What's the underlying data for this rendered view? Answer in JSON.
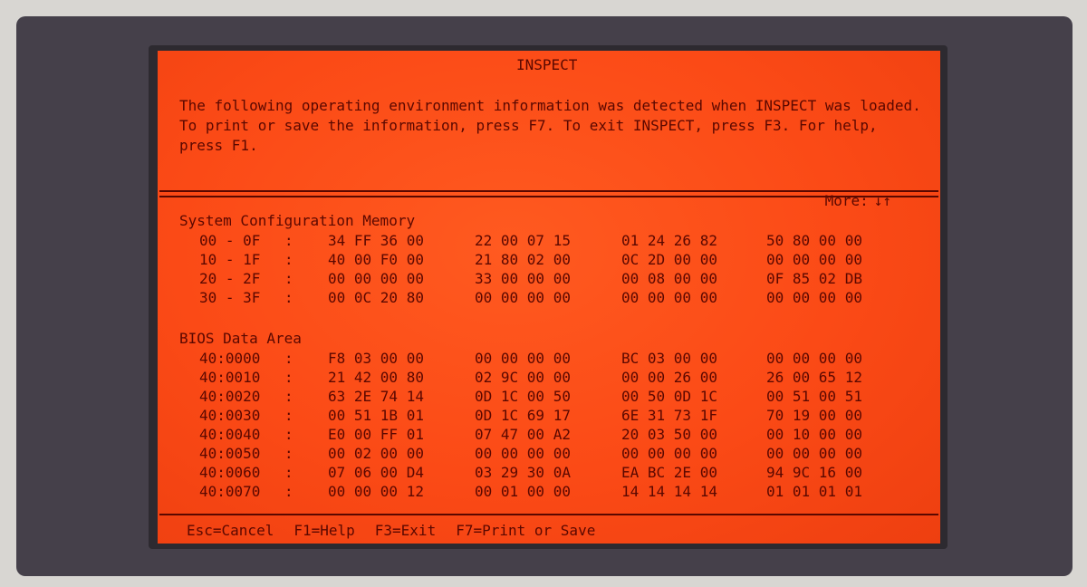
{
  "window": {
    "title": "INSPECT"
  },
  "intro": {
    "text": "The following operating environment information was detected when INSPECT was loaded. To print or save the information, press F7. To exit INSPECT, press F3. For help, press F1."
  },
  "more": {
    "label": "More:",
    "arrow": "↓↑"
  },
  "colors": {
    "screen": "#fb4a16",
    "text": "#5a0800",
    "bezel": "#45404a"
  },
  "system_config": {
    "title": "System Configuration Memory",
    "rows": [
      {
        "addr": "00 - 0F",
        "groups": [
          "34 FF 36 00",
          "22 00 07 15",
          "01 24 26 82",
          "50 80 00 00"
        ]
      },
      {
        "addr": "10 - 1F",
        "groups": [
          "40 00 F0 00",
          "21 80 02 00",
          "0C 2D 00 00",
          "00 00 00 00"
        ]
      },
      {
        "addr": "20 - 2F",
        "groups": [
          "00 00 00 00",
          "33 00 00 00",
          "00 08 00 00",
          "0F 85 02 DB"
        ]
      },
      {
        "addr": "30 - 3F",
        "groups": [
          "00 0C 20 80",
          "00 00 00 00",
          "00 00 00 00",
          "00 00 00 00"
        ]
      }
    ]
  },
  "bios_data": {
    "title": "BIOS Data Area",
    "rows": [
      {
        "addr": "40:0000",
        "groups": [
          "F8 03 00 00",
          "00 00 00 00",
          "BC 03 00 00",
          "00 00 00 00"
        ]
      },
      {
        "addr": "40:0010",
        "groups": [
          "21 42 00 80",
          "02 9C 00 00",
          "00 00 26 00",
          "26 00 65 12"
        ]
      },
      {
        "addr": "40:0020",
        "groups": [
          "63 2E 74 14",
          "0D 1C 00 50",
          "00 50 0D 1C",
          "00 51 00 51"
        ]
      },
      {
        "addr": "40:0030",
        "groups": [
          "00 51 1B 01",
          "0D 1C 69 17",
          "6E 31 73 1F",
          "70 19 00 00"
        ]
      },
      {
        "addr": "40:0040",
        "groups": [
          "E0 00 FF 01",
          "07 47 00 A2",
          "20 03 50 00",
          "00 10 00 00"
        ]
      },
      {
        "addr": "40:0050",
        "groups": [
          "00 02 00 00",
          "00 00 00 00",
          "00 00 00 00",
          "00 00 00 00"
        ]
      },
      {
        "addr": "40:0060",
        "groups": [
          "07 06 00 D4",
          "03 29 30 0A",
          "EA BC 2E 00",
          "94 9C 16 00"
        ]
      },
      {
        "addr": "40:0070",
        "groups": [
          "00 00 00 12",
          "00 01 00 00",
          "14 14 14 14",
          "01 01 01 01"
        ]
      }
    ]
  },
  "footer": {
    "keys": [
      "Esc=Cancel",
      "F1=Help",
      "F3=Exit",
      "F7=Print or Save"
    ]
  }
}
